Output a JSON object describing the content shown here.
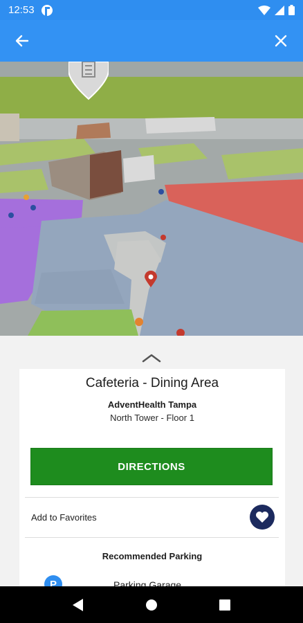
{
  "status_bar": {
    "time": "12:53",
    "icons": [
      "app-notification-icon",
      "wifi-icon",
      "signal-icon",
      "battery-icon"
    ]
  },
  "app_bar": {
    "back_icon": "arrow-left-icon",
    "close_icon": "close-icon",
    "color": "#3392f3"
  },
  "map": {
    "building_marker_icon": "building-icon",
    "selected_pin_icon": "location-pin-icon"
  },
  "sheet": {
    "handle_icon": "chevron-up-icon",
    "title": "Cafeteria - Dining Area",
    "facility": "AdventHealth Tampa",
    "location": "North Tower - Floor 1",
    "directions_label": "DIRECTIONS",
    "directions_color": "#1e8c1e",
    "favorites_label": "Add to Favorites",
    "favorites_icon": "heart-icon",
    "parking_heading": "Recommended Parking",
    "parking": [
      {
        "icon": "P",
        "name": "Parking Garage"
      }
    ]
  },
  "nav_bar": {
    "back": "nav-back-icon",
    "home": "nav-home-icon",
    "recents": "nav-recents-icon"
  }
}
